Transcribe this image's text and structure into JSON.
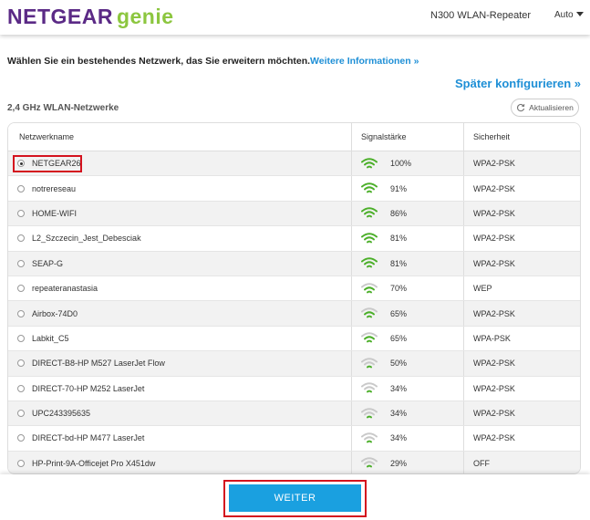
{
  "header": {
    "logo_netgear": "NETGEAR",
    "logo_genie": "genie",
    "device": "N300 WLAN-Repeater",
    "language": "Auto"
  },
  "instruction": {
    "text": "Wählen Sie ein bestehendes Netzwerk, das Sie erweitern möchten.",
    "link": "Weitere Informationen »"
  },
  "later_link": "Später konfigurieren »",
  "section_title": "2,4 GHz WLAN-Netzwerke",
  "refresh_label": "Aktualisieren",
  "table": {
    "headers": [
      "Netzwerkname",
      "Signalstärke",
      "Sicherheit"
    ],
    "rows": [
      {
        "name": "NETGEAR26",
        "signal": "100%",
        "security": "WPA2-PSK",
        "bars": 3,
        "selected": true
      },
      {
        "name": "notrereseau",
        "signal": "91%",
        "security": "WPA2-PSK",
        "bars": 3
      },
      {
        "name": "HOME-WIFI",
        "signal": "86%",
        "security": "WPA2-PSK",
        "bars": 3
      },
      {
        "name": "L2_Szczecin_Jest_Debesciak",
        "signal": "81%",
        "security": "WPA2-PSK",
        "bars": 3
      },
      {
        "name": "SEAP-G",
        "signal": "81%",
        "security": "WPA2-PSK",
        "bars": 3
      },
      {
        "name": "repeateranastasia",
        "signal": "70%",
        "security": "WEP",
        "bars": 2
      },
      {
        "name": "Airbox-74D0",
        "signal": "65%",
        "security": "WPA2-PSK",
        "bars": 2
      },
      {
        "name": "Labkit_C5",
        "signal": "65%",
        "security": "WPA-PSK",
        "bars": 2
      },
      {
        "name": "DIRECT-B8-HP M527 LaserJet Flow",
        "signal": "50%",
        "security": "WPA2-PSK",
        "bars": 1
      },
      {
        "name": "DIRECT-70-HP M252 LaserJet",
        "signal": "34%",
        "security": "WPA2-PSK",
        "bars": 1
      },
      {
        "name": "UPC243395635",
        "signal": "34%",
        "security": "WPA2-PSK",
        "bars": 1
      },
      {
        "name": "DIRECT-bd-HP M477 LaserJet",
        "signal": "34%",
        "security": "WPA2-PSK",
        "bars": 1
      },
      {
        "name": "HP-Print-9A-Officejet Pro X451dw",
        "signal": "29%",
        "security": "OFF",
        "bars": 1
      }
    ]
  },
  "button_label": "WEITER",
  "colors": {
    "brand_purple": "#5b2a86",
    "genie_green": "#8cc63f",
    "link_blue": "#1e8fd6",
    "button_blue": "#1aa0e0",
    "highlight_red": "#d4121e",
    "wifi_green": "#4caf2a",
    "wifi_gray": "#c9c9c9"
  }
}
